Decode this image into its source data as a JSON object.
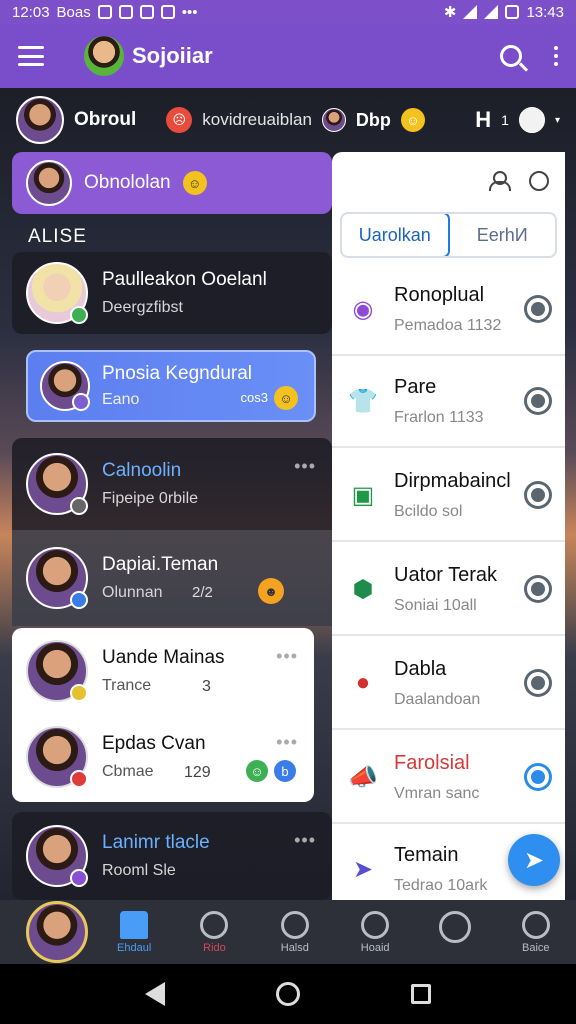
{
  "status_bar": {
    "time_left": "12:03",
    "carrier": "Boas",
    "time_right": "13:43",
    "more": "•••"
  },
  "app_bar": {
    "title": "Sojoiiar",
    "menu_icon": "hamburger-icon",
    "search_icon": "search-icon",
    "more_icon": "more-vert-icon"
  },
  "status_strip": {
    "name": "Obroul",
    "status_text": "kovidreuaiblan",
    "tag": "Dbp",
    "right_mark": "H",
    "right_count": "1"
  },
  "chat_list": {
    "active": {
      "name": "Obnololan"
    },
    "section_label": "ALISE",
    "items": [
      {
        "name": "Paulleakon Ooelanl",
        "sub": "Deergzfibst",
        "badge_color": "#3db054"
      },
      {
        "name": "Pnosia Kegndural",
        "sub": "Eano",
        "extra": "cos3",
        "badge_color": "#7b5fd1"
      },
      {
        "name": "Calnoolin",
        "sub": "Fipeipe 0rbile",
        "badge_color": "#666666"
      },
      {
        "name": "Dapiai.Teman",
        "sub": "Olunnan",
        "extra": "2/2",
        "badge_color": "#3a7de6"
      },
      {
        "name": "Uande Mainas",
        "sub": "Trance",
        "extra": "3",
        "badge_color": "#e6c12e"
      },
      {
        "name": "Epdas Cvan",
        "sub": "Cbmae",
        "extra": "129",
        "badge_color": "#e03b3b"
      },
      {
        "name": "Lanimr tlacle",
        "sub": "Rooml Sle",
        "badge_color": "#8a4fd0"
      }
    ]
  },
  "right_panel": {
    "tabs": [
      {
        "label": "Uarolkan"
      },
      {
        "label": "EerhИ"
      }
    ],
    "items": [
      {
        "title": "Ronoplual",
        "sub": "Pemadoa 1132",
        "icon": "camera-icon",
        "icon_color": "#8e4ad6",
        "gear": "settings-icon"
      },
      {
        "title": "Pare",
        "sub": "Frarlon 1133",
        "icon": "shirt-icon",
        "icon_color": "#1e8c4a",
        "gear": "settings-icon"
      },
      {
        "title": "Dirpmabaincl",
        "sub": "Bcildo sol",
        "icon": "image-icon",
        "icon_color": "#1e9a46",
        "gear": "settings-icon"
      },
      {
        "title": "Uator Terak",
        "sub": "Soniai 10all",
        "icon": "shield-icon",
        "icon_color": "#1e8c4a",
        "gear": "settings-icon"
      },
      {
        "title": "Dabla",
        "sub": "Daalandoan",
        "icon": "apple-icon",
        "icon_color": "#d32f2f",
        "gear": "settings-icon"
      },
      {
        "title": "Farolsial",
        "sub": "Vmran sanc",
        "icon": "megaphone-icon",
        "icon_color": "#f0b323",
        "gear": "settings-icon",
        "highlight_color": "#d63a3a"
      },
      {
        "title": "Temain",
        "sub": "Tedrao 10ark",
        "icon": "send-icon",
        "icon_color": "#5b4fd1",
        "gear": "settings-icon"
      }
    ],
    "fab_icon": "send-icon"
  },
  "bottom_nav": {
    "items": [
      {
        "label": "Ehdaul",
        "icon": "home-icon"
      },
      {
        "label": "Rido",
        "icon": "search-icon"
      },
      {
        "label": "Halsd",
        "icon": "person-icon"
      },
      {
        "label": "Hoaid",
        "icon": "profile-icon"
      },
      {
        "label": "",
        "icon": "group-icon"
      },
      {
        "label": "Baice",
        "icon": "user-icon"
      }
    ]
  },
  "colors": {
    "brand": "#7a4ecb",
    "accent": "#2e8ff0"
  }
}
